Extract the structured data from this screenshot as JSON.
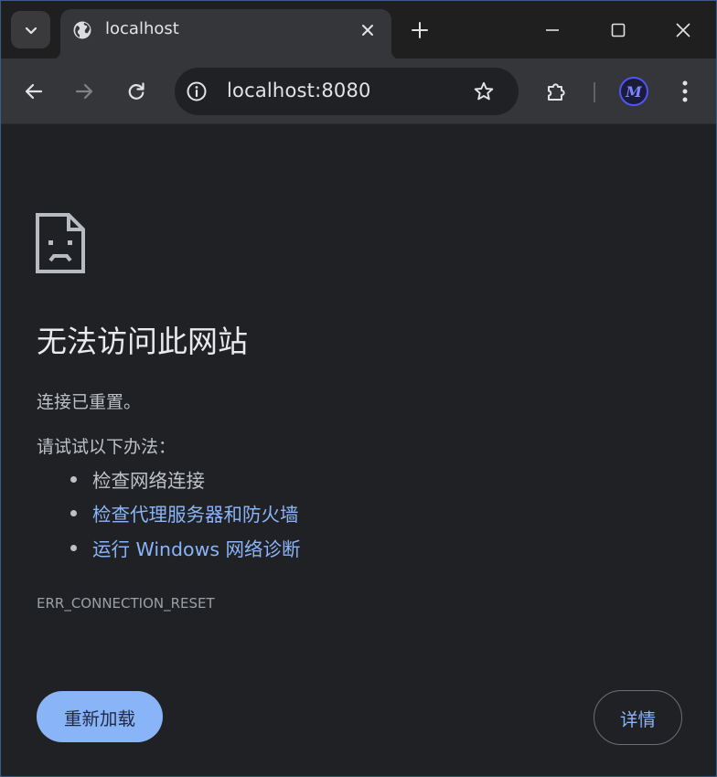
{
  "tab": {
    "title": "localhost",
    "favicon": "globe-icon"
  },
  "toolbar": {
    "url": "localhost:8080"
  },
  "error": {
    "heading": "无法访问此网站",
    "subtitle": "连接已重置。",
    "try_title": "请试试以下办法：",
    "suggestions": [
      {
        "text": "检查网络连接",
        "link": false
      },
      {
        "text": "检查代理服务器和防火墙",
        "link": true
      },
      {
        "text": "运行 Windows 网络诊断",
        "link": true
      }
    ],
    "code": "ERR_CONNECTION_RESET"
  },
  "buttons": {
    "reload": "重新加载",
    "details": "详情"
  },
  "profile": {
    "initial": "M"
  },
  "colors": {
    "link": "#8ab4f8",
    "primary_button": "#8ab4f8",
    "background": "#202124"
  }
}
